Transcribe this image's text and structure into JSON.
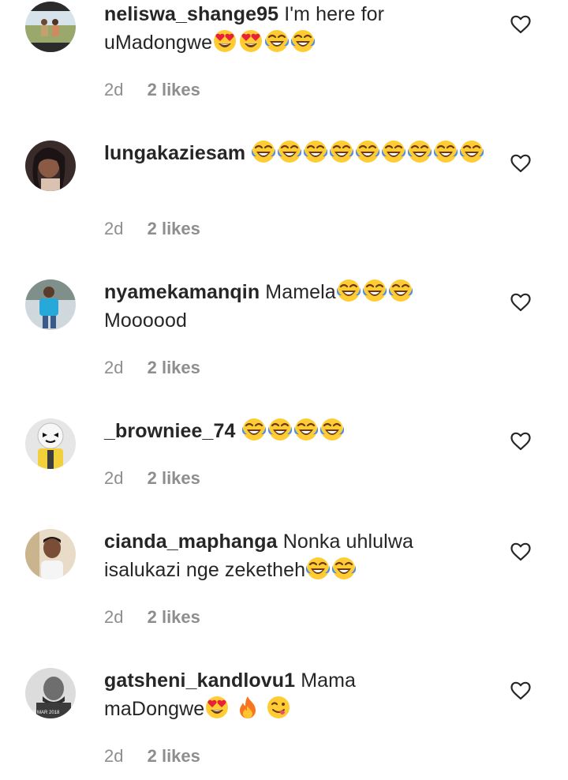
{
  "comments": [
    {
      "username": "neliswa_shange95",
      "text": "I'm here for uMadongwe",
      "emojis": [
        "heart-eyes-emoji",
        "heart-eyes-emoji",
        "tears-of-joy-emoji",
        "tears-of-joy-emoji"
      ],
      "time": "2d",
      "likes": "2 likes"
    },
    {
      "username": "lungakaziesam",
      "text": "",
      "emojis": [
        "tears-of-joy-emoji",
        "tears-of-joy-emoji",
        "tears-of-joy-emoji",
        "tears-of-joy-emoji",
        "tears-of-joy-emoji",
        "tears-of-joy-emoji",
        "tears-of-joy-emoji",
        "tears-of-joy-emoji",
        "tears-of-joy-emoji"
      ],
      "time": "2d",
      "likes": "2 likes"
    },
    {
      "username": "nyamekamanqin",
      "text": "Mamela",
      "text2": "Moooood",
      "emojis": [
        "tears-of-joy-emoji",
        "tears-of-joy-emoji",
        "tears-of-joy-emoji"
      ],
      "time": "2d",
      "likes": "2 likes"
    },
    {
      "username": "_browniee_74",
      "text": "",
      "emojis": [
        "tears-of-joy-emoji",
        "tears-of-joy-emoji",
        "tears-of-joy-emoji",
        "tears-of-joy-emoji"
      ],
      "time": "2d",
      "likes": "2 likes"
    },
    {
      "username": "cianda_maphanga",
      "text": "Nonka uhlulwa",
      "text2": "isalukazi nge zeketheh",
      "emojis": [
        "tears-of-joy-emoji",
        "tears-of-joy-emoji"
      ],
      "time": "2d",
      "likes": "2 likes"
    },
    {
      "username": "gatsheni_kandlovu1",
      "text": "Mama",
      "text2": "maDongwe",
      "emojis": [
        "heart-eyes-emoji",
        "fire-emoji",
        "yum-emoji"
      ],
      "time": "2d",
      "likes": "2 likes",
      "avatar_stamp": "3B MAR 2018"
    }
  ]
}
